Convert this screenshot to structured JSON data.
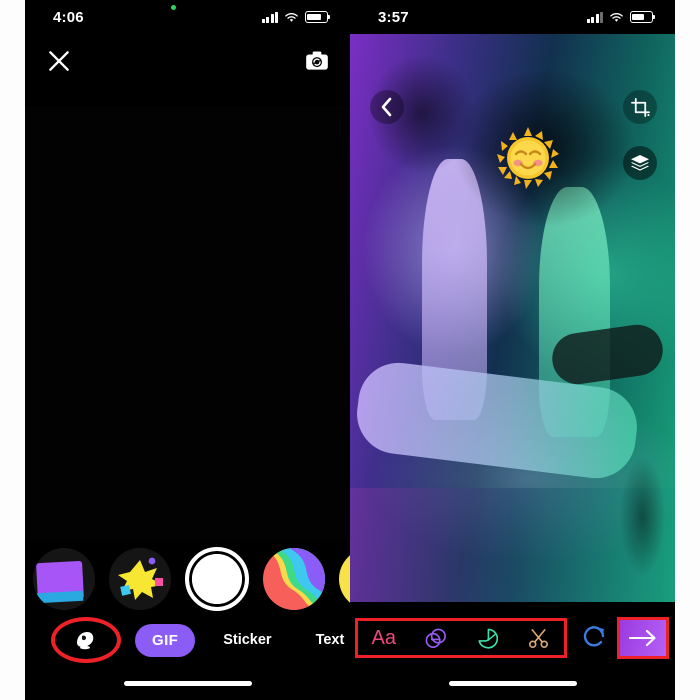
{
  "left_phone": {
    "status_bar": {
      "time": "4:06",
      "recording_dot": "green-recording-dot",
      "cellular_icon": "cellular-bars-icon",
      "wifi_icon": "wifi-icon",
      "battery_icon": "battery-icon"
    },
    "camera_screen": {
      "close_icon": "close-icon",
      "flip_camera_icon": "camera-flip-icon",
      "flash_off_icon": "flash-off-icon"
    },
    "lens_carousel": [
      {
        "name": "lens-purple-square",
        "colors": [
          "#8b2ae0",
          "#a855f7",
          "#2aa8e0"
        ]
      },
      {
        "name": "lens-star-burst",
        "colors": [
          "#f7e733",
          "#8b5cf6",
          "#ff4fa3",
          "#3ec8f0"
        ]
      },
      {
        "name": "lens-shutter-button",
        "colors": [
          "#ffffff"
        ]
      },
      {
        "name": "lens-rainbow-swirl",
        "colors": [
          "#f7605a",
          "#f7d94a",
          "#3fd98a",
          "#3ec8f0",
          "#8b5cf6"
        ]
      },
      {
        "name": "lens-smiley-face",
        "colors": [
          "#f7e24a",
          "#e8731c",
          "#5a4ae0"
        ]
      }
    ],
    "mode_bar": {
      "lens_button_icon": "memories-lens-icon",
      "lens_button_highlighted": true,
      "gif_label": "GIF",
      "gif_color": "#8b5cf6",
      "sticker_label": "Sticker",
      "text_label": "Text"
    },
    "home_indicator": "home-indicator"
  },
  "right_phone": {
    "status_bar": {
      "time": "3:57",
      "cellular_icon": "cellular-bars-icon",
      "wifi_icon": "wifi-icon",
      "battery_icon": "battery-icon"
    },
    "editor_screen": {
      "back_icon": "chevron-left-icon",
      "crop_icon": "crop-icon",
      "layers_icon": "layers-icon",
      "sticker_on_photo": "sun-smiling-emoji-sticker",
      "photo_description": "Two musicians playing acoustic guitars on a stage with purple to green gradient lighting"
    },
    "edit_toolbar": {
      "highlighted": true,
      "highlight_color": "#ef2128",
      "tools": [
        {
          "name": "text-tool",
          "label": "Aa",
          "color": "#f0487e"
        },
        {
          "name": "draw-tool",
          "label": "draw-overlap-icon",
          "color": "#9b5cf6"
        },
        {
          "name": "sticker-tool",
          "label": "sticker-icon",
          "color": "#3fe0a8"
        },
        {
          "name": "crop-scissors-tool",
          "label": "scissors-icon",
          "color": "#d9a878"
        }
      ],
      "redo_icon": "redo-icon",
      "redo_color": "#3b7de0",
      "send_button_icon": "arrow-right-icon",
      "send_button_colors": [
        "#9b3ae0",
        "#b561f5"
      ]
    },
    "home_indicator": "home-indicator"
  }
}
